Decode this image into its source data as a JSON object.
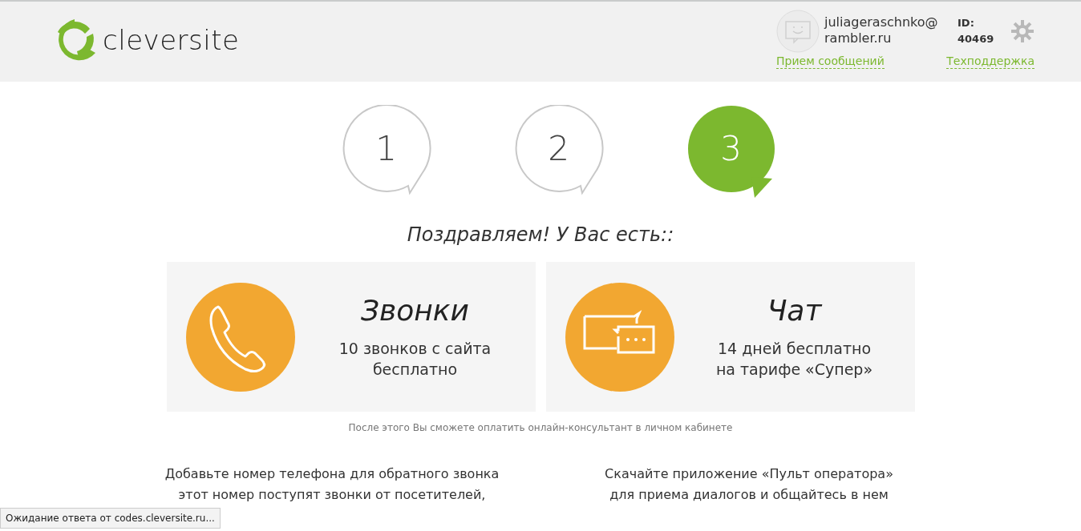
{
  "header": {
    "logo": "cleversite",
    "user": {
      "email_lines": [
        "juliageraschnko@",
        "rambler.ru"
      ],
      "id_label": "ID:",
      "id_value": "40469"
    },
    "links": [
      "Прием сообщений",
      "Техподдержка"
    ]
  },
  "steps": [
    {
      "label": "1",
      "selected": false
    },
    {
      "label": "2",
      "selected": false
    },
    {
      "label": "3",
      "selected": true
    }
  ],
  "heading": "Поздравляем! У Вас есть::",
  "offers": [
    {
      "kind": "phone",
      "title": "Звонки",
      "lines": [
        "10 звонков с сайта",
        "бесплатно"
      ]
    },
    {
      "kind": "chat",
      "title": "Чат",
      "lines": [
        "14 дней бесплатно",
        "на тарифе «Супер»"
      ]
    }
  ],
  "note": "После этого Вы сможете оплатить онлайн-консультант в личном кабинете",
  "instructions": [
    {
      "lines": [
        "Добавьте номер телефона для обратного звонка",
        "этот номер поступят звонки от посетителей,"
      ]
    },
    {
      "lines": [
        "Скачайте приложение «Пульт оператора»",
        "для приема диалогов и общайтесь в нем"
      ]
    }
  ],
  "status_bar": "Ожидание ответа от codes.cleversite.ru..."
}
